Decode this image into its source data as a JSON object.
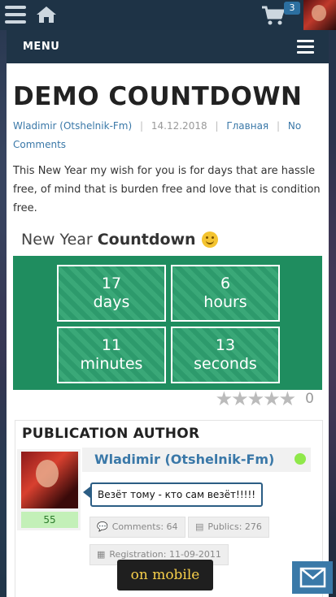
{
  "topbar": {
    "cart_count": "3",
    "icons": [
      "menu-icon",
      "home-icon",
      "cart-icon",
      "avatar"
    ]
  },
  "menu": {
    "label": "MENU"
  },
  "post": {
    "title": "DEMO COUNTDOWN",
    "author": "Wladimir (Otshelnik-Fm)",
    "date": "14.12.2018",
    "category": "Главная",
    "comments_link": "No Comments",
    "intro": "This New Year my wish for you is for days that are hassle free, of mind that is burden free and love that is condition free."
  },
  "countdown": {
    "title_prefix": "New Year",
    "title_bold": "Countdown",
    "cells": [
      {
        "value": "17",
        "unit": "days"
      },
      {
        "value": "6",
        "unit": "hours"
      },
      {
        "value": "11",
        "unit": "minutes"
      },
      {
        "value": "13",
        "unit": "seconds"
      }
    ],
    "color": "#1f8d5f"
  },
  "rating": {
    "stars": 0,
    "max": 5,
    "count": "0"
  },
  "author_box": {
    "heading": "PUBLICATION AUTHOR",
    "name": "Wladimir (Otshelnik-Fm)",
    "level": "55",
    "status": "Везёт тому - кто сам везёт!!!!!",
    "comments": "Comments: 64",
    "publics": "Publics: 276",
    "registration": "Registration: 11-09-2011",
    "online_color": "#8fe84a"
  },
  "buttons": {
    "mobile": "on mobile"
  }
}
